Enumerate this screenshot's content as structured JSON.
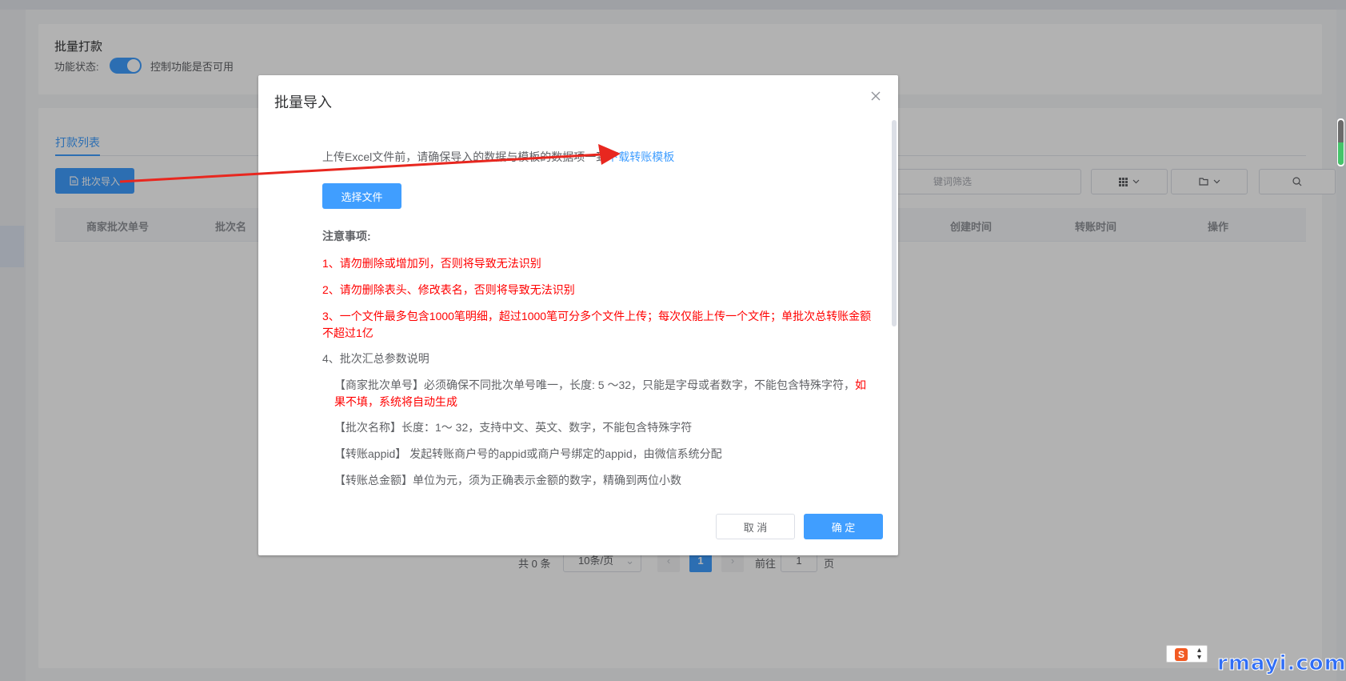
{
  "settings_card": {
    "title": "批量打款",
    "status_label": "功能状态:",
    "toggle_on": true,
    "hint": "控制功能是否可用"
  },
  "list_card": {
    "tab_label": "打款列表",
    "batch_import_label": "批次导入",
    "search_placeholder": "键词筛选",
    "columns": [
      "商家批次单号",
      "批次名",
      "创建时间",
      "转账时间",
      "操作"
    ]
  },
  "pagination": {
    "total": "共 0 条",
    "page_size": "10条/页",
    "current_page": "1",
    "goto_label": "前往",
    "goto_value": "1",
    "page_unit": "页"
  },
  "dialog": {
    "title": "批量导入",
    "intro_text": "上传Excel文件前，请确保导入的数据与模板的数据项一致",
    "download_link": "下载转账模板",
    "select_file_label": "选择文件",
    "notes_title": "注意事项:",
    "note_1": "1、请勿删除或增加列，否则将导致无法识别",
    "note_2": "2、请勿删除表头、修改表名，否则将导致无法识别",
    "note_3": "3、一个文件最多包含1000笔明细，超过1000笔可分多个文件上传；每次仅能上传一个文件；单批次总转账金额不超过1亿",
    "note_4": "4、批次汇总参数说明",
    "param_1": "【商家批次单号】必须确保不同批次单号唯一，长度: 5 ～32，只能是字母或者数字，不能包含特殊字符，",
    "param_1_red": "如果不填，系统将自动生成",
    "param_2": "【批次名称】长度：1～ 32，支持中文、英文、数字，不能包含特殊字符",
    "param_3": "【转账appid】 发起转账商户号的appid或商户号绑定的appid，由微信系统分配",
    "param_4": "【转账总金额】单位为元，须为正确表示金额的数字，精确到两位小数",
    "cancel_label": "取 消",
    "confirm_label": "确 定"
  },
  "watermark": "rmayi.com",
  "ime_label": "S",
  "colors": {
    "primary": "#409eff",
    "warning_text": "#ff0000",
    "arrow": "#e8271f"
  }
}
